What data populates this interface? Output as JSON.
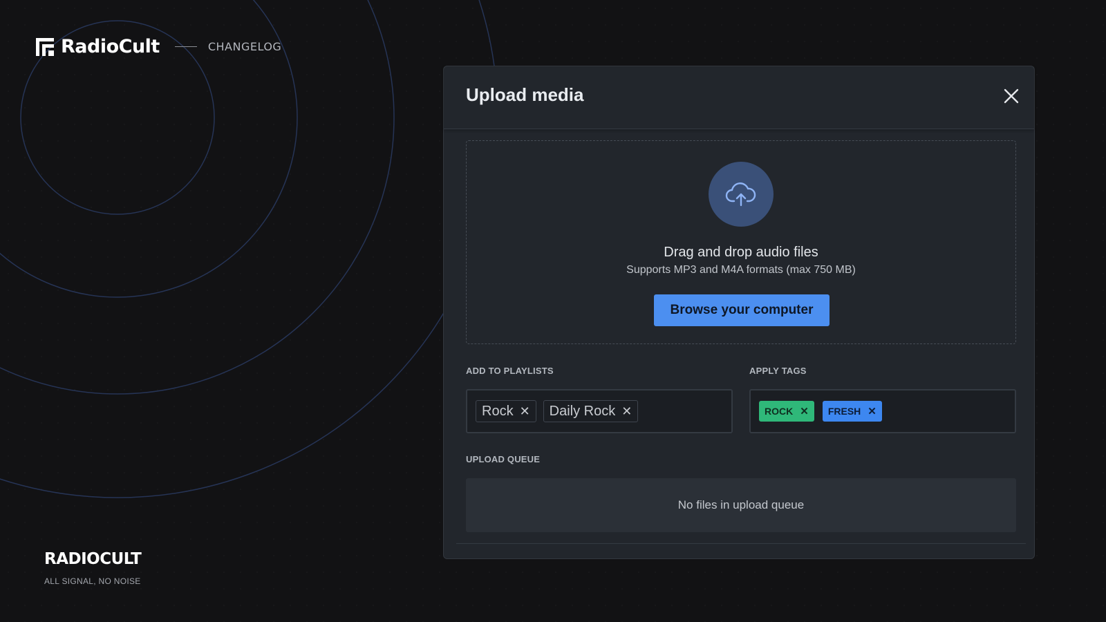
{
  "brand": {
    "name": "RadioCult",
    "link": "CHANGELOG"
  },
  "footer": {
    "name": "RADIOCULT",
    "tagline": "ALL SIGNAL, NO NOISE"
  },
  "modal": {
    "title": "Upload media",
    "close_icon": "close-icon",
    "dropzone": {
      "icon": "cloud-upload-icon",
      "title": "Drag and drop audio files",
      "subtitle": "Supports MP3 and M4A formats (max 750 MB)",
      "button": "Browse your computer"
    },
    "playlists": {
      "label": "ADD TO PLAYLISTS",
      "items": [
        {
          "label": "Rock"
        },
        {
          "label": "Daily Rock"
        }
      ]
    },
    "tags": {
      "label": "APPLY TAGS",
      "items": [
        {
          "label": "ROCK",
          "color": "#2fb879"
        },
        {
          "label": "FRESH",
          "color": "#3d87f0"
        }
      ]
    },
    "queue": {
      "label": "UPLOAD QUEUE",
      "empty_text": "No files in upload queue"
    }
  },
  "colors": {
    "background": "#121214",
    "modal": "#22262c",
    "accent": "#4c8ff0",
    "ring": "#263456"
  }
}
